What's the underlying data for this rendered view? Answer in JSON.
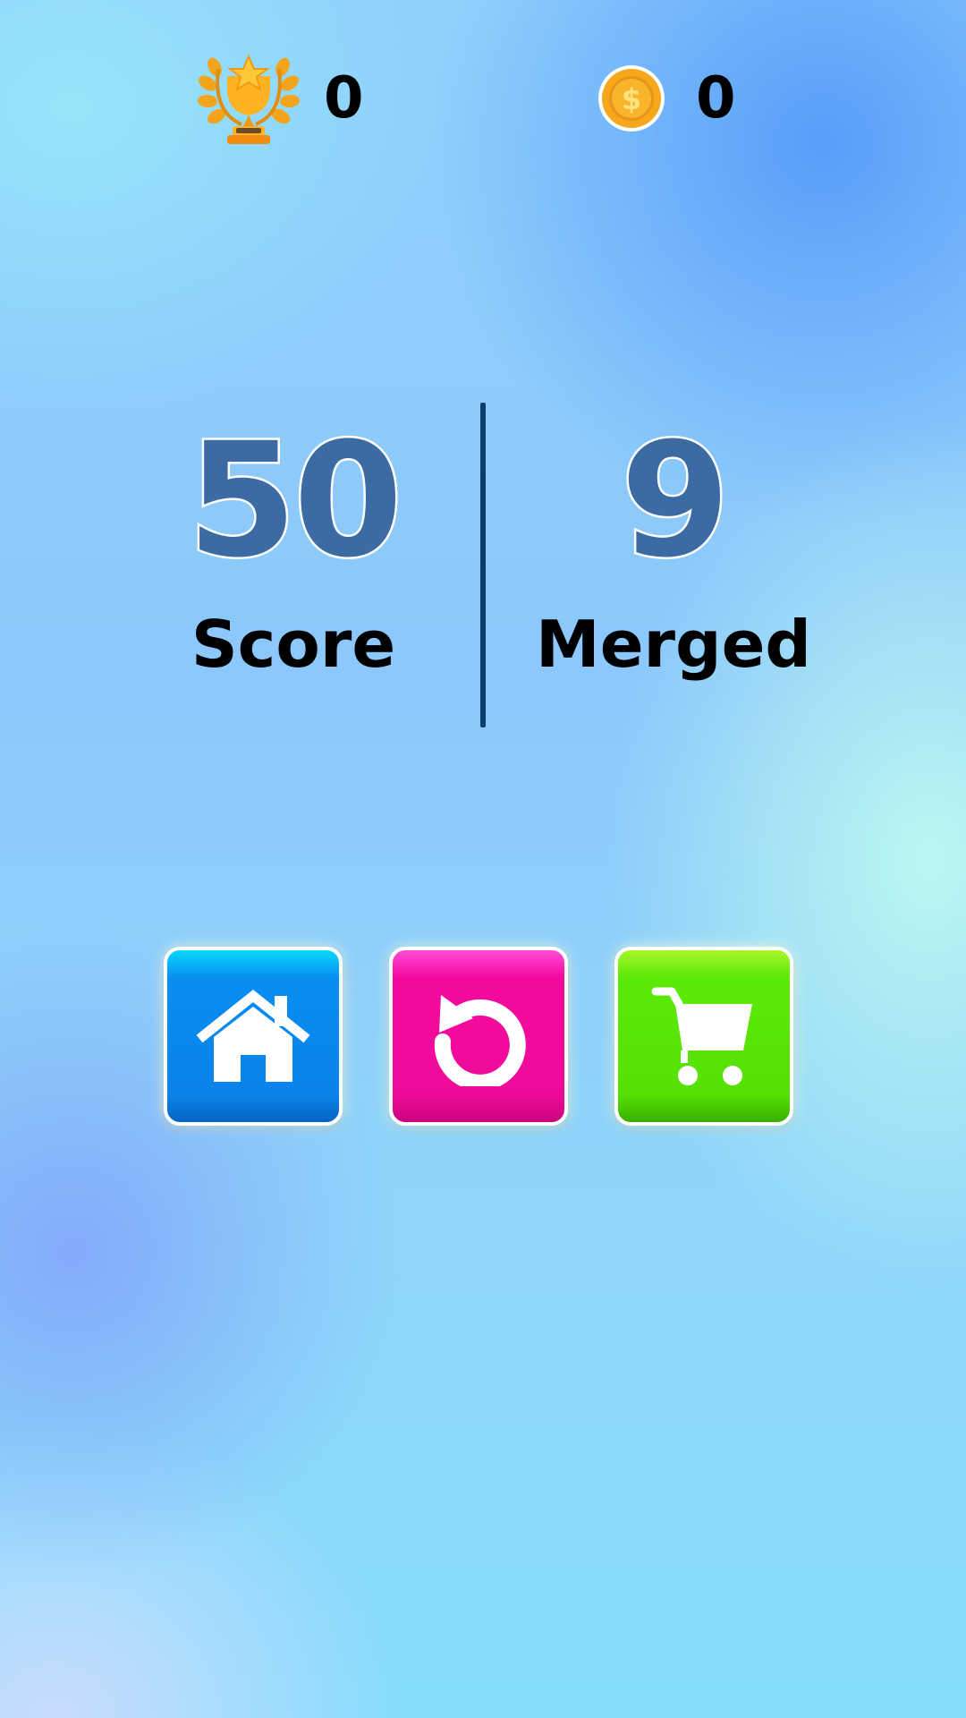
{
  "top_bar": {
    "trophies": {
      "icon": "trophy-icon",
      "value": "0"
    },
    "coins": {
      "icon": "coin-icon",
      "value": "0"
    }
  },
  "results": {
    "score": {
      "value": "50",
      "label": "Score"
    },
    "merged": {
      "value": "9",
      "label": "Merged"
    }
  },
  "actions": [
    {
      "id": "home",
      "icon": "home-icon",
      "color": "#0a83ea"
    },
    {
      "id": "replay",
      "icon": "replay-icon",
      "color": "#ef0b99"
    },
    {
      "id": "shop",
      "icon": "cart-icon",
      "color": "#55e004"
    }
  ],
  "colors": {
    "value_fill": "#3c6aa2",
    "divider": "#0e3d6e",
    "label": "#000000"
  }
}
